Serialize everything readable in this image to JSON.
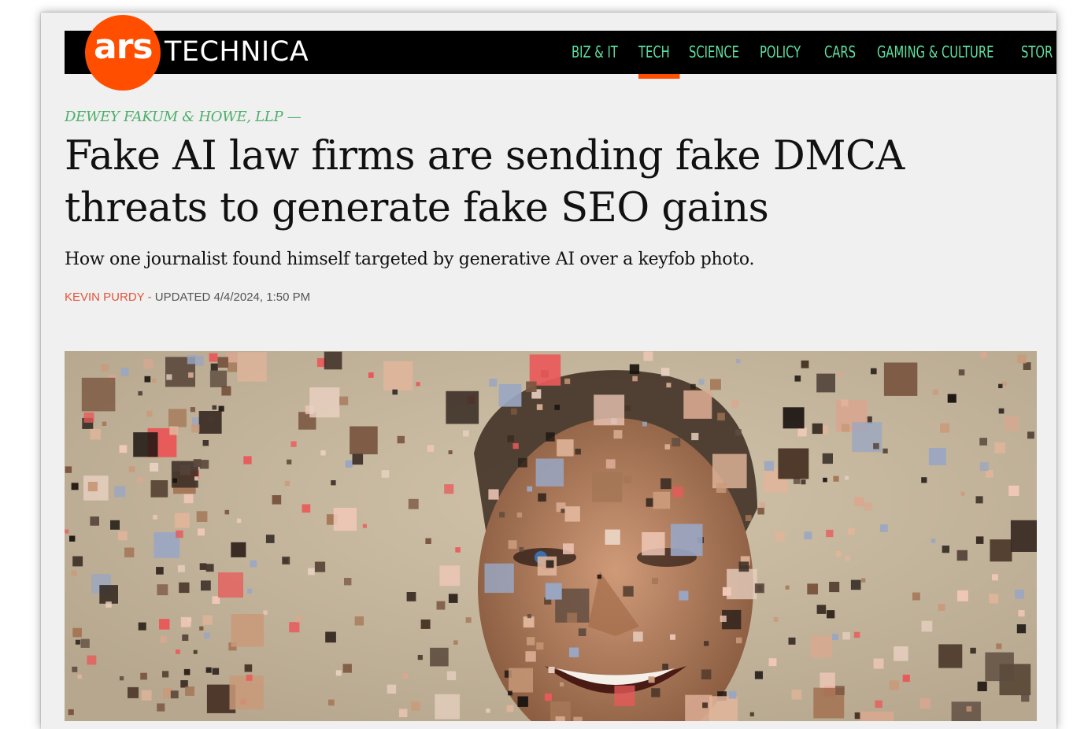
{
  "site": {
    "logo_ars": "ars",
    "logo_technica": "TECHNICA"
  },
  "nav": {
    "items": [
      "BIZ & IT",
      "TECH",
      "SCIENCE",
      "POLICY",
      "CARS",
      "GAMING & CULTURE",
      "STOR"
    ],
    "active": "TECH",
    "text_color": "#5ee0a0",
    "accent_color": "#ff4e00"
  },
  "article": {
    "kicker": "DEWEY FAKUM & HOWE, LLP —",
    "headline": "Fake AI law firms are sending fake DMCA threats to generate fake SEO gains",
    "dek": "How one journalist found himself targeted by generative AI over a keyfob photo.",
    "author": "KEVIN PURDY",
    "separator": " - ",
    "updated": "UPDATED 4/4/2024, 1:50 PM"
  },
  "hero_image": {
    "subject": "collage of scattered square photo fragments forming a smiling face"
  }
}
